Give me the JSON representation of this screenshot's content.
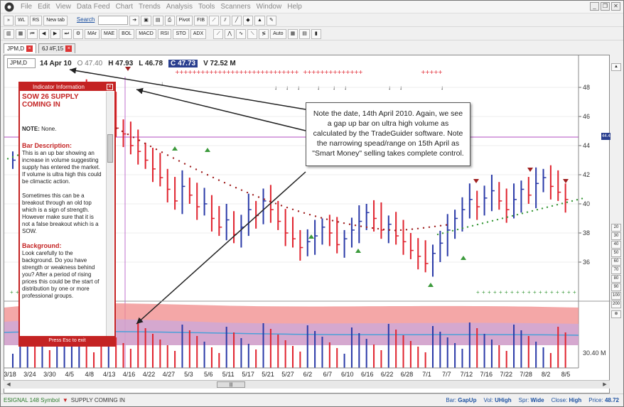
{
  "menubar": {
    "items": [
      "File",
      "Edit",
      "View",
      "Data Feed",
      "Chart",
      "Trends",
      "Analysis",
      "Tools",
      "Scanners",
      "Window",
      "Help"
    ]
  },
  "toolbar1": {
    "wl_label": "WL",
    "rs_label": "RS",
    "new_tab_label": "New tab",
    "search_label": "Search",
    "pivot_label": "Pivot",
    "fib_label": "FIB"
  },
  "toolbar2": {
    "buttons": [
      "MAr",
      "MAE",
      "BOL",
      "MACD",
      "RSI",
      "STO",
      "ADX"
    ],
    "auto_label": "Auto"
  },
  "tabs": [
    {
      "label": "JPM,D",
      "active": true
    },
    {
      "label": "6J #F,15",
      "active": false
    }
  ],
  "chart": {
    "symbol": "JPM,D",
    "date": "14 Apr 10",
    "open_label": "O",
    "open": "47.40",
    "high_label": "H",
    "high": "47.93",
    "low_label": "L",
    "low": "46.78",
    "close_label": "C",
    "close": "47.73",
    "volume_label": "V",
    "volume": "72.52 M",
    "price_ticks": [
      "48",
      "46",
      "44",
      "42",
      "40",
      "38",
      "36"
    ],
    "current_price_tag": "44.48",
    "volume_tick": "30.40 M",
    "date_ticks": [
      "3/18",
      "3/24",
      "3/30",
      "4/5",
      "4/8",
      "4/13",
      "4/16",
      "4/22",
      "4/27",
      "5/3",
      "5/6",
      "5/11",
      "5/17",
      "5/21",
      "5/27",
      "6/2",
      "6/7",
      "6/10",
      "6/16",
      "6/22",
      "6/28",
      "7/1",
      "7/7",
      "7/12",
      "7/16",
      "7/22",
      "7/28",
      "8/2",
      "8/5"
    ],
    "colors": {
      "up_bar": "#2a3aa8",
      "down_bar": "#e0232e",
      "sell_marker": "#e0232e",
      "buy_marker": "#3c9a3c",
      "volume_band": "#f08a8a",
      "ma_red": "#a02020",
      "ma_green": "#3c9a3c"
    }
  },
  "indicator_panel": {
    "title": "Indicator Information",
    "heading": "SOW 26 SUPPLY COMING IN",
    "note_label": "NOTE:",
    "note_value": "None.",
    "bar_description_title": "Bar Description:",
    "bar_description": "This is an up bar showing an increase in volume suggesting supply has entered the market. If volume is ultra high this could be climactic action.",
    "bar_description_2": "Sometimes this can be a breakout through an old top which is a sign of strength. However make sure that it is not a false breakout which is a SOW.",
    "background_title": "Background:",
    "background": "Look carefully to the background. Do you have strength or weakness behind you? After a period of rising prices this could be the start of distribution by one or more professional groups.",
    "footer": "Press Esc to exit"
  },
  "callout": {
    "text": "Note the date, 14th April 2010. Again, we see a gap up bar on ultra high volume as calculated by the TradeGuider software. Note the narrowing spead/range on 15th April as \"Smart Money\" selling takes complete control."
  },
  "side_buttons": [
    "20",
    "30",
    "40",
    "50",
    "60",
    "70",
    "80",
    "90",
    "100",
    "200"
  ],
  "statusbar": {
    "left_text": "ESIGNAL 148 Symbol",
    "signal_text": "SUPPLY COMING IN",
    "bar_label": "Bar:",
    "bar_value": "GapUp",
    "vol_label": "Vol:",
    "vol_value": "UHigh",
    "spr_label": "Spr:",
    "spr_value": "Wide",
    "close_label": "Close:",
    "close_value": "High",
    "price_label": "Price:",
    "price_value": "48.72"
  }
}
